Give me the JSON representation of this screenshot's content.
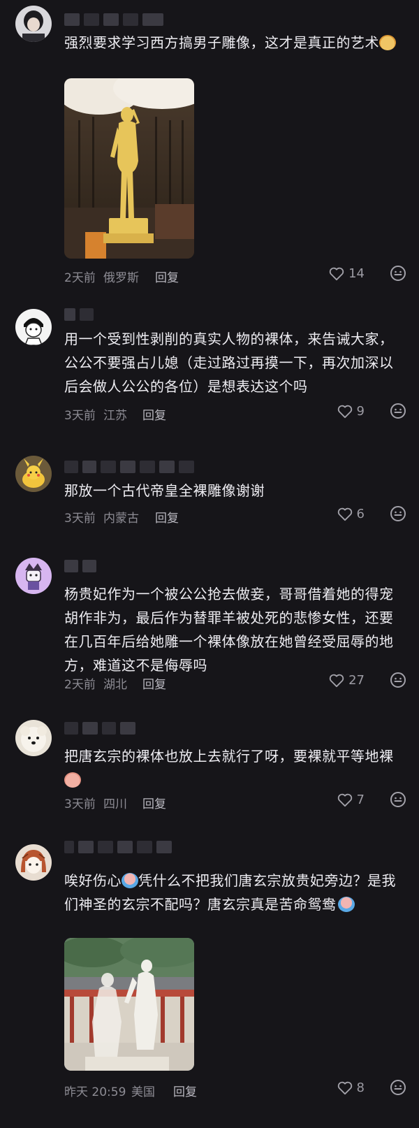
{
  "comments": [
    {
      "text": "强烈要求学习西方搞男子雕像，这才是真正的艺术",
      "emoji_after": "tiger",
      "time": "2天前",
      "region": "俄罗斯",
      "reply_label": "回复",
      "likes": "14",
      "has_image": true,
      "image_subject": "golden-nude-male-statue"
    },
    {
      "text": "用一个受到性剥削的真实人物的裸体，来告诫大家，公公不要强占儿媳（走过路过再摸一下，再次加深以后会做人公公的各位）是想表达这个吗",
      "time": "3天前",
      "region": "江苏",
      "reply_label": "回复",
      "likes": "9"
    },
    {
      "text": "那放一个古代帝皇全裸雕像谢谢",
      "time": "3天前",
      "region": "内蒙古",
      "reply_label": "回复",
      "likes": "6"
    },
    {
      "text": "杨贵妃作为一个被公公抢去做妾，哥哥借着她的得宠胡作非为，最后作为替罪羊被处死的悲惨女性，还要在几百年后给她雕一个裸体像放在她曾经受屈辱的地方，难道这不是侮辱吗",
      "time": "2天前",
      "region": "湖北",
      "reply_label": "回复",
      "likes": "27"
    },
    {
      "text": "把唐玄宗的裸体也放上去就行了呀，要裸就平等地裸",
      "emoji_after": "pig",
      "time": "3天前",
      "region": "四川",
      "reply_label": "回复",
      "likes": "7"
    },
    {
      "text_part1": "唉好伤心",
      "text_part2": "凭什么不把我们唐玄宗放贵妃旁边？是我们神圣的玄宗不配吗？唐玄宗真是苦命鸳鸯",
      "time": "昨天 20:59",
      "region": "美国",
      "reply_label": "回复",
      "likes": "8",
      "has_image": true,
      "image_subject": "white-female-statue-before-palace"
    }
  ],
  "icons": {
    "like": "heart-outline-icon",
    "emoji_react": "smiley-face-icon"
  },
  "colors": {
    "background": "#161519",
    "text": "#eeedf2",
    "meta": "#8d8c94"
  }
}
